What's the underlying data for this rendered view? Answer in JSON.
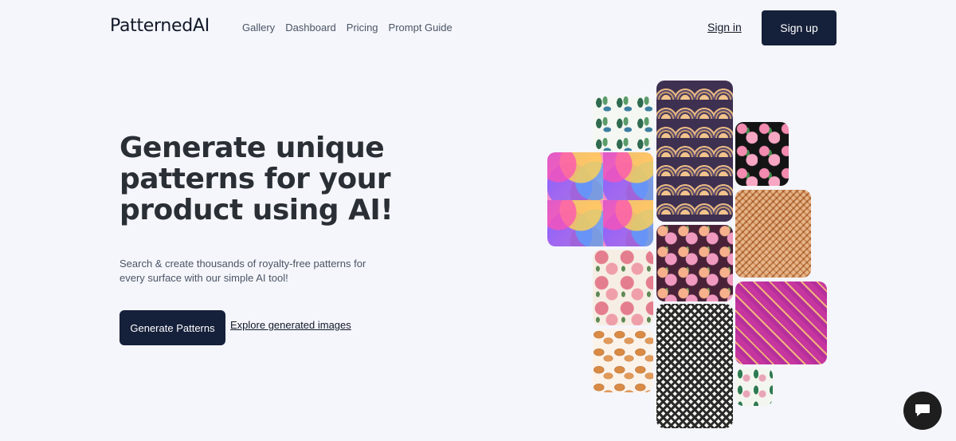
{
  "brand": {
    "logo": "PatternedAI"
  },
  "nav": {
    "links": [
      "Gallery",
      "Dashboard",
      "Pricing",
      "Prompt Guide"
    ],
    "sign_in": "Sign in",
    "sign_up": "Sign up"
  },
  "hero": {
    "title": "Generate unique patterns for your product using AI!",
    "subtitle": "Search & create thousands of royalty-free patterns for every surface with our simple AI tool!",
    "cta_primary": "Generate Patterns",
    "cta_secondary": "Explore generated images"
  },
  "gallery": {
    "tiles": [
      {
        "name": "tile-teal-leaves",
        "style": "t-leaves"
      },
      {
        "name": "tile-art-deco-fans",
        "style": "t-artdeco"
      },
      {
        "name": "tile-pink-roses-black",
        "style": "t-roses-dark"
      },
      {
        "name": "tile-colorful-circles",
        "style": "t-circles"
      },
      {
        "name": "tile-peach-diamonds",
        "style": "t-diamond-peach"
      },
      {
        "name": "tile-floral-purple",
        "style": "t-floral-purple"
      },
      {
        "name": "tile-pink-roses-cream",
        "style": "t-roses-cream"
      },
      {
        "name": "tile-magenta-lattice",
        "style": "t-lattice-pink"
      },
      {
        "name": "tile-pastries",
        "style": "t-pastries"
      },
      {
        "name": "tile-black-white-diamonds",
        "style": "t-bw-diamond"
      },
      {
        "name": "tile-small-leaves",
        "style": "t-leaves-small"
      }
    ]
  },
  "chat": {
    "icon": "chat-bubble-icon"
  }
}
